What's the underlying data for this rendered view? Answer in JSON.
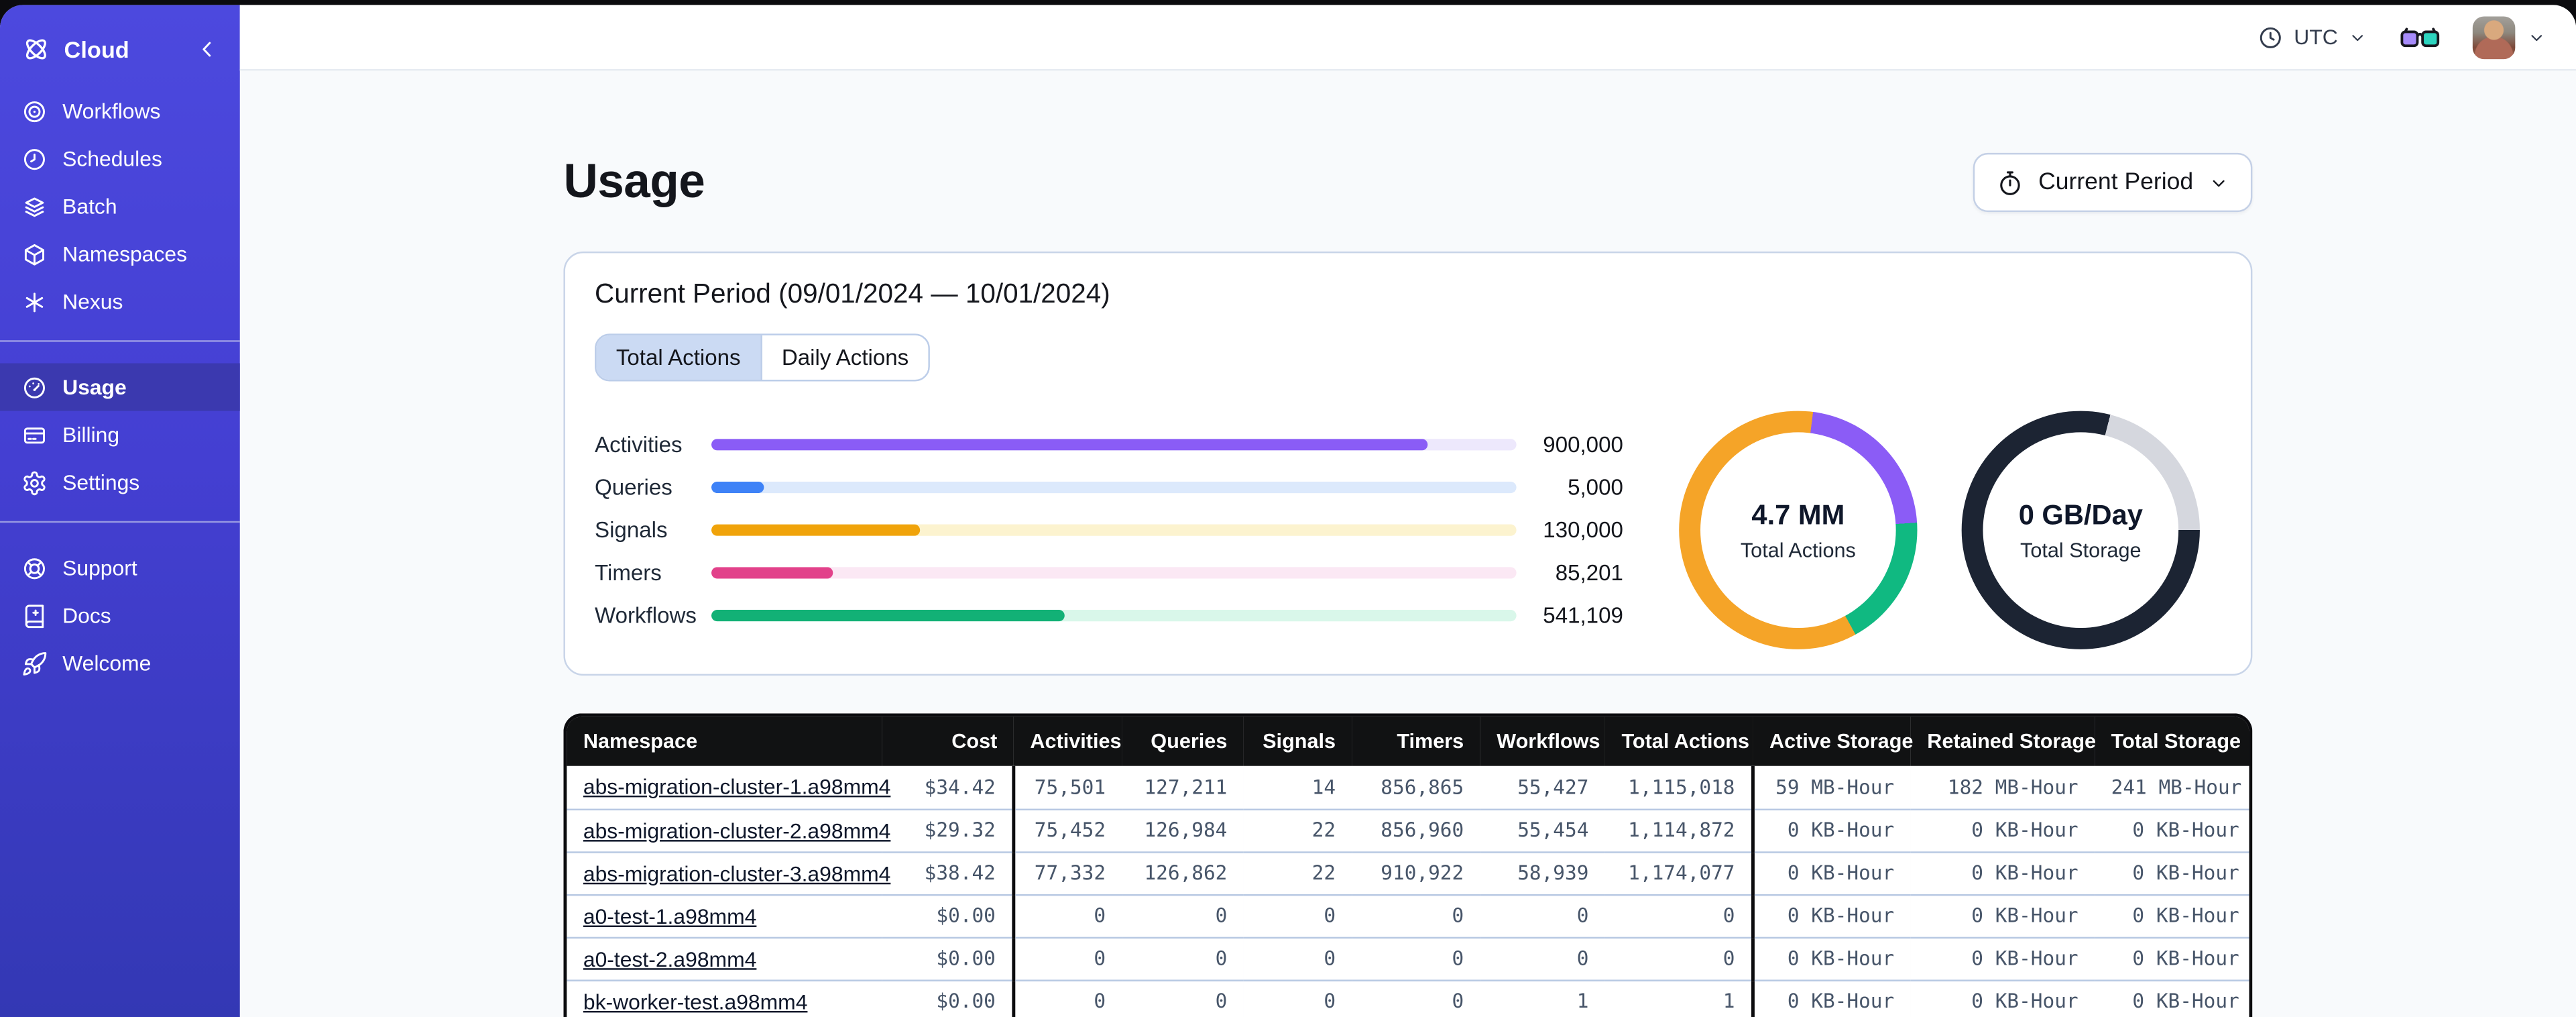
{
  "sidebar": {
    "brand": "Cloud",
    "sections": [
      {
        "items": [
          {
            "id": "workflows",
            "label": "Workflows",
            "icon": "workflows"
          },
          {
            "id": "schedules",
            "label": "Schedules",
            "icon": "schedules"
          },
          {
            "id": "batch",
            "label": "Batch",
            "icon": "batch"
          },
          {
            "id": "namespaces",
            "label": "Namespaces",
            "icon": "namespaces"
          },
          {
            "id": "nexus",
            "label": "Nexus",
            "icon": "nexus"
          }
        ]
      },
      {
        "items": [
          {
            "id": "usage",
            "label": "Usage",
            "icon": "usage",
            "active": true
          },
          {
            "id": "billing",
            "label": "Billing",
            "icon": "billing"
          },
          {
            "id": "settings",
            "label": "Settings",
            "icon": "settings"
          }
        ]
      },
      {
        "items": [
          {
            "id": "support",
            "label": "Support",
            "icon": "support"
          },
          {
            "id": "docs",
            "label": "Docs",
            "icon": "docs"
          },
          {
            "id": "welcome",
            "label": "Welcome",
            "icon": "welcome"
          }
        ]
      }
    ]
  },
  "topbar": {
    "timezone": "UTC"
  },
  "page": {
    "title": "Usage",
    "period_button_label": "Current Period"
  },
  "card": {
    "heading": "Current Period (09/01/2024 — 10/01/2024)",
    "tabs": [
      {
        "id": "total-actions",
        "label": "Total Actions",
        "active": true
      },
      {
        "id": "daily-actions",
        "label": "Daily Actions",
        "active": false
      }
    ],
    "bars": [
      {
        "label": "Activities",
        "value": "900,000",
        "fraction": 0.89,
        "color": "#8A5CF6",
        "track": "#EDE8FC"
      },
      {
        "label": "Queries",
        "value": "5,000",
        "fraction": 0.065,
        "color": "#3E82F7",
        "track": "#DCE9FC"
      },
      {
        "label": "Signals",
        "value": "130,000",
        "fraction": 0.26,
        "color": "#F0A30A",
        "track": "#FCF3CF"
      },
      {
        "label": "Timers",
        "value": "85,201",
        "fraction": 0.151,
        "color": "#E2418A",
        "track": "#FBE8F4"
      },
      {
        "label": "Workflows",
        "value": "541,109",
        "fraction": 0.438,
        "color": "#12B176",
        "track": "#D9F7EA"
      }
    ],
    "donuts": [
      {
        "value": "4.7 MM",
        "label": "Total Actions",
        "segments": [
          {
            "color": "#F5A428",
            "from": 0,
            "to": 2
          },
          {
            "color": "#8B5CF6",
            "from": 2,
            "to": 24
          },
          {
            "color": "#10B981",
            "from": 24,
            "to": 42
          },
          {
            "color": "#F5A428",
            "from": 42,
            "to": 100
          }
        ]
      },
      {
        "value": "0 GB/Day",
        "label": "Total Storage",
        "segments": [
          {
            "color": "#1C2433",
            "from": 0,
            "to": 4
          },
          {
            "color": "#D5D7DE",
            "from": 4,
            "to": 25
          },
          {
            "color": "#1C2433",
            "from": 25,
            "to": 100
          }
        ]
      }
    ]
  },
  "table": {
    "columns": [
      {
        "label": "Namespace",
        "align": "left",
        "width": 192
      },
      {
        "label": "Cost",
        "align": "right",
        "width": 80,
        "group_end": true
      },
      {
        "label": "Activities",
        "align": "right",
        "width": 66
      },
      {
        "label": "Queries",
        "align": "right",
        "width": 74
      },
      {
        "label": "Signals",
        "align": "right",
        "width": 66
      },
      {
        "label": "Timers",
        "align": "right",
        "width": 78
      },
      {
        "label": "Workflows",
        "align": "right",
        "width": 76
      },
      {
        "label": "Total Actions",
        "align": "right",
        "width": 90,
        "group_end": true
      },
      {
        "label": "Active Storage",
        "align": "right",
        "width": 96
      },
      {
        "label": "Retained Storage",
        "align": "right",
        "width": 112
      },
      {
        "label": "Total Storage",
        "align": "right",
        "width": 98
      }
    ],
    "rows": [
      [
        "abs-migration-cluster-1.a98mm4",
        "$34.42",
        "75,501",
        "127,211",
        "14",
        "856,865",
        "55,427",
        "1,115,018",
        "59 MB-Hour",
        "182 MB-Hour",
        "241 MB-Hour"
      ],
      [
        "abs-migration-cluster-2.a98mm4",
        "$29.32",
        "75,452",
        "126,984",
        "22",
        "856,960",
        "55,454",
        "1,114,872",
        "0 KB-Hour",
        "0 KB-Hour",
        "0 KB-Hour"
      ],
      [
        "abs-migration-cluster-3.a98mm4",
        "$38.42",
        "77,332",
        "126,862",
        "22",
        "910,922",
        "58,939",
        "1,174,077",
        "0 KB-Hour",
        "0 KB-Hour",
        "0 KB-Hour"
      ],
      [
        "a0-test-1.a98mm4",
        "$0.00",
        "0",
        "0",
        "0",
        "0",
        "0",
        "0",
        "0 KB-Hour",
        "0 KB-Hour",
        "0 KB-Hour"
      ],
      [
        "a0-test-2.a98mm4",
        "$0.00",
        "0",
        "0",
        "0",
        "0",
        "0",
        "0",
        "0 KB-Hour",
        "0 KB-Hour",
        "0 KB-Hour"
      ],
      [
        "bk-worker-test.a98mm4",
        "$0.00",
        "0",
        "0",
        "0",
        "0",
        "1",
        "1",
        "0 KB-Hour",
        "0 KB-Hour",
        "0 KB-Hour"
      ]
    ]
  }
}
